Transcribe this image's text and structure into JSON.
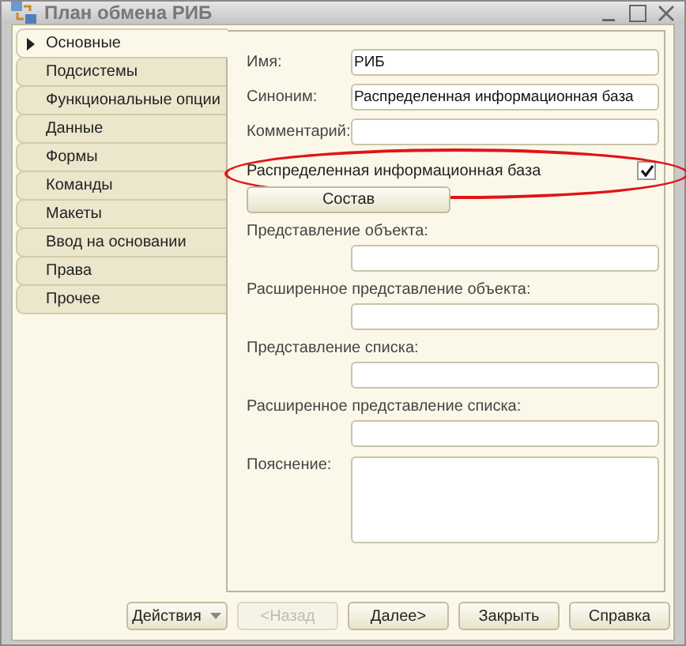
{
  "window": {
    "title": "План обмена РИБ"
  },
  "tabs": [
    {
      "label": "Основные",
      "selected": true
    },
    {
      "label": "Подсистемы",
      "selected": false
    },
    {
      "label": "Функциональные опции",
      "selected": false
    },
    {
      "label": "Данные",
      "selected": false
    },
    {
      "label": "Формы",
      "selected": false
    },
    {
      "label": "Команды",
      "selected": false
    },
    {
      "label": "Макеты",
      "selected": false
    },
    {
      "label": "Ввод на основании",
      "selected": false
    },
    {
      "label": "Права",
      "selected": false
    },
    {
      "label": "Прочее",
      "selected": false
    }
  ],
  "fields": [
    {
      "kind": "inline",
      "label": "Имя:",
      "value": "РИБ"
    },
    {
      "kind": "inline",
      "label": "Синоним:",
      "value": "Распределенная информационная база"
    },
    {
      "kind": "inline",
      "label": "Комментарий:"
    },
    {
      "kind": "checkbox",
      "label": "Распределенная информационная база",
      "checked": true,
      "highlighted": true
    },
    {
      "kind": "button",
      "label": "Состав"
    },
    {
      "kind": "stacked",
      "label": "Представление объекта:"
    },
    {
      "kind": "stacked",
      "label": "Расширенное представление объекта:"
    },
    {
      "kind": "stacked",
      "label": "Представление списка:"
    },
    {
      "kind": "stacked",
      "label": "Расширенное представление списка:"
    },
    {
      "kind": "textarea",
      "label": "Пояснение:"
    }
  ],
  "buttons": [
    {
      "label": "Действия",
      "kind": "menu",
      "disabled": false
    },
    {
      "label": "<Назад",
      "kind": "plain",
      "disabled": true
    },
    {
      "label": "Далее>",
      "kind": "plain",
      "disabled": false
    },
    {
      "label": "Закрыть",
      "kind": "plain",
      "disabled": false
    },
    {
      "label": "Справка",
      "kind": "plain",
      "disabled": false
    }
  ]
}
